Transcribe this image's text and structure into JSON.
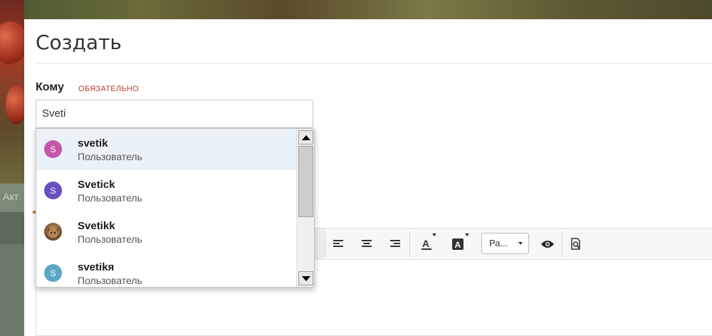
{
  "background": {
    "left_tab_text": "Акт"
  },
  "form": {
    "title": "Создать",
    "to_label": "Кому",
    "required_label": "ОБЯЗАТЕЛЬНО",
    "to_value": "Sveti"
  },
  "dropdown": {
    "items": [
      {
        "name": "svetik",
        "role": "Пользователь",
        "avatar_letter": "S",
        "avatar_color": "#c455a8",
        "active": true
      },
      {
        "name": "Svetick",
        "role": "Пользователь",
        "avatar_letter": "S",
        "avatar_color": "#6a4fc0",
        "active": false
      },
      {
        "name": "Svetikk",
        "role": "Пользователь",
        "avatar_letter": "",
        "avatar_color": "#8a6a4a",
        "active": false
      },
      {
        "name": "svetikя",
        "role": "Пользователь",
        "avatar_letter": "S",
        "avatar_color": "#5aa7c4",
        "active": false
      }
    ]
  },
  "toolbar": {
    "paragraph_select": "Ра...",
    "icons": [
      "align-left-icon",
      "align-center-icon",
      "align-right-icon",
      "text-color-icon",
      "background-color-icon",
      "preview-eye-icon",
      "search-document-icon"
    ]
  },
  "colors": {
    "required": "#c0392b",
    "active_item_bg": "#eaf1f7",
    "panel_bg": "#ffffff"
  }
}
